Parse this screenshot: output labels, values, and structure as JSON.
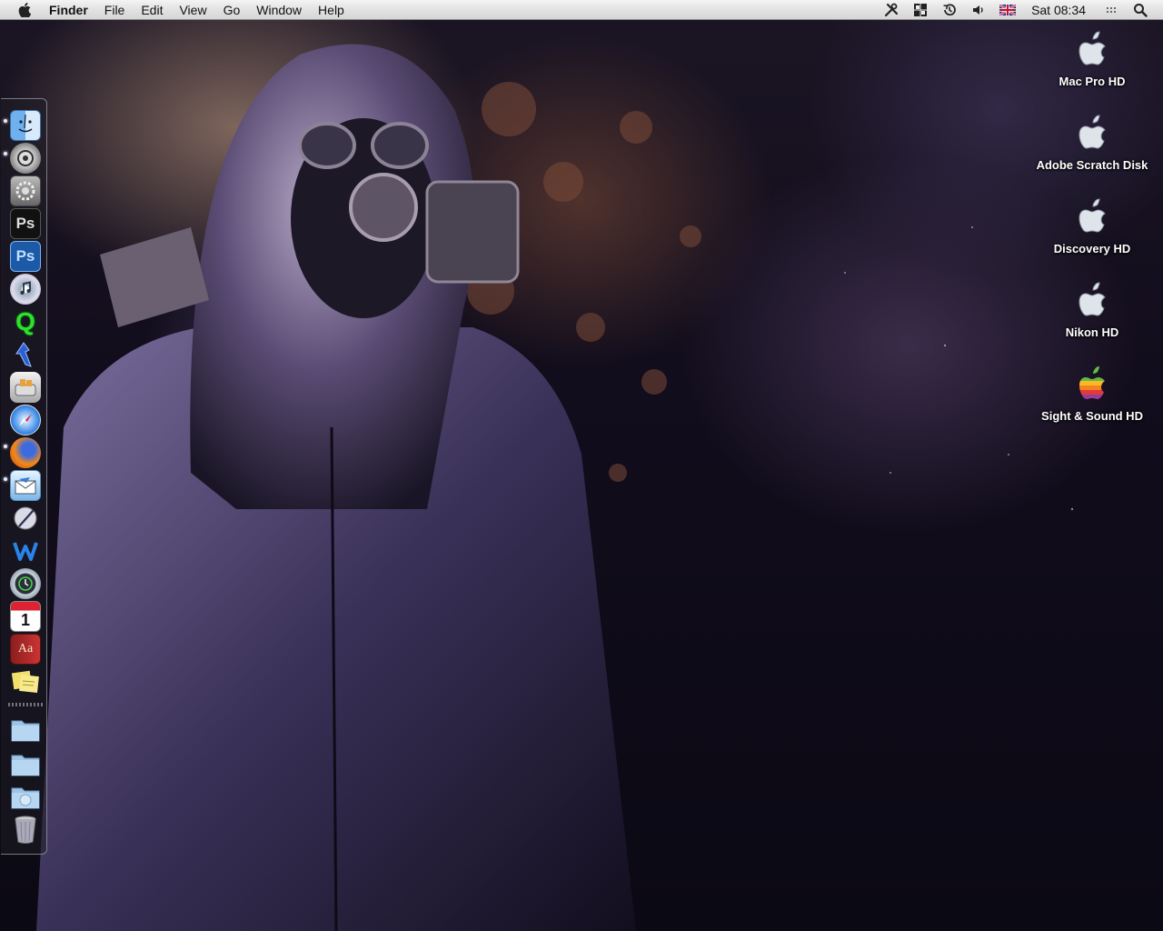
{
  "menubar": {
    "apple_icon": "apple-logo-icon",
    "app_name": "Finder",
    "menus": [
      "File",
      "Edit",
      "View",
      "Go",
      "Window",
      "Help"
    ],
    "status_icons": [
      "tools-icon",
      "spaces-icon",
      "time-machine-icon",
      "volume-icon",
      "uk-flag-icon"
    ],
    "clock": "Sat 08:34",
    "extras_icon": "dots-icon",
    "spotlight_icon": "spotlight-search-icon"
  },
  "dock": {
    "apps": [
      {
        "name": "finder-icon",
        "text": "",
        "running": true
      },
      {
        "name": "system-status-icon",
        "text": "",
        "running": true
      },
      {
        "name": "system-preferences-icon",
        "text": "",
        "running": false
      },
      {
        "name": "photoshop-dark-icon",
        "text": "Ps",
        "running": false
      },
      {
        "name": "photoshop-blue-icon",
        "text": "Ps",
        "running": false
      },
      {
        "name": "itunes-icon",
        "text": "",
        "running": false
      },
      {
        "name": "quicktime-icon",
        "text": "Q",
        "running": false
      },
      {
        "name": "automator-icon",
        "text": "",
        "running": false
      },
      {
        "name": "toaster-icon",
        "text": "",
        "running": false
      },
      {
        "name": "safari-icon",
        "text": "",
        "running": false
      },
      {
        "name": "firefox-icon",
        "text": "",
        "running": true
      },
      {
        "name": "mail-icon",
        "text": "",
        "running": true
      },
      {
        "name": "script-editor-icon",
        "text": "",
        "running": false
      },
      {
        "name": "ftp-client-icon",
        "text": "",
        "running": false
      },
      {
        "name": "time-machine-icon",
        "text": "",
        "running": false
      },
      {
        "name": "ical-icon",
        "text": "1",
        "running": false
      },
      {
        "name": "dictionary-icon",
        "text": "Aa",
        "running": false
      },
      {
        "name": "stickies-icon",
        "text": "",
        "running": false
      }
    ],
    "stacks": [
      {
        "name": "folder-stack-icon"
      },
      {
        "name": "folder-stack-2-icon"
      },
      {
        "name": "downloads-stack-icon"
      },
      {
        "name": "trash-icon"
      }
    ]
  },
  "desktop": {
    "drives": [
      {
        "label": "Mac Pro HD",
        "icon": "apple-drive-icon"
      },
      {
        "label": "Adobe Scratch Disk",
        "icon": "apple-drive-icon"
      },
      {
        "label": "Discovery HD",
        "icon": "apple-drive-icon"
      },
      {
        "label": "Nikon HD",
        "icon": "apple-drive-icon"
      },
      {
        "label": "Sight & Sound HD",
        "icon": "rainbow-apple-drive-icon"
      }
    ]
  }
}
